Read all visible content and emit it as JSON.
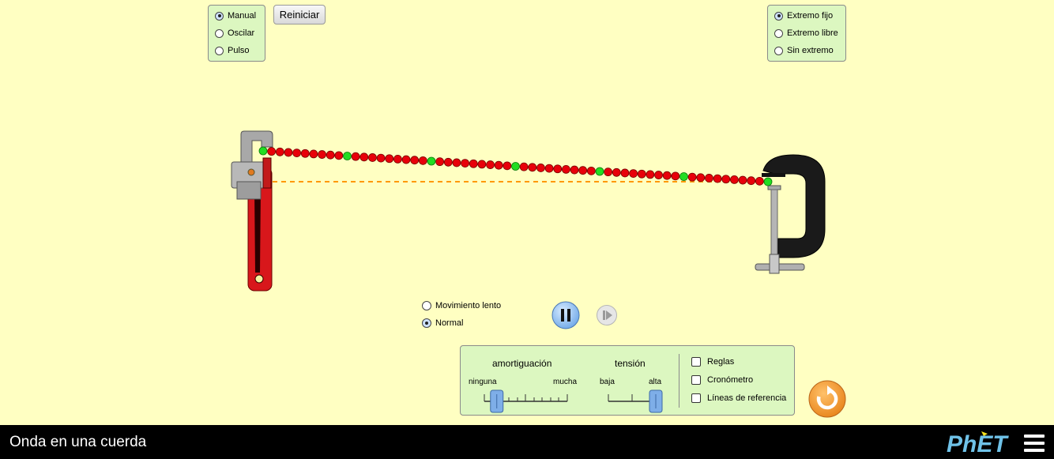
{
  "wave_mode": {
    "options": [
      {
        "label": "Manual",
        "selected": true
      },
      {
        "label": "Oscilar",
        "selected": false
      },
      {
        "label": "Pulso",
        "selected": false
      }
    ]
  },
  "reset_label": "Reiniciar",
  "end_mode": {
    "options": [
      {
        "label": "Extremo fijo",
        "selected": true
      },
      {
        "label": "Extremo libre",
        "selected": false
      },
      {
        "label": "Sin extremo",
        "selected": false
      }
    ]
  },
  "speed": {
    "options": [
      {
        "label": "Movimiento lento",
        "selected": false
      },
      {
        "label": "Normal",
        "selected": true
      }
    ]
  },
  "controls": {
    "damping": {
      "title": "amortiguación",
      "min_label": "ninguna",
      "max_label": "mucha",
      "value": 0.15
    },
    "tension": {
      "title": "tensión",
      "min_label": "baja",
      "max_label": "alta",
      "value": 1.0
    },
    "checkboxes": [
      {
        "label": "Reglas",
        "checked": false
      },
      {
        "label": "Cronómetro",
        "checked": false
      },
      {
        "label": "Líneas de referencia",
        "checked": false
      }
    ]
  },
  "footer": {
    "title": "Onda en una cuerda",
    "logo": "PhET",
    "menu_icon": "hamburger-menu-icon"
  },
  "colors": {
    "background": "#ffffc2",
    "panel": "#dcf7c0",
    "bead_red": "#e8000a",
    "bead_green": "#22dd22",
    "reference_line": "#ff9900",
    "reset_all": "#f3941d"
  },
  "icons": {
    "wrench": "pipe-wrench-icon",
    "clamp": "c-clamp-icon",
    "pause": "pause-icon",
    "step": "step-forward-icon",
    "reset_all": "reset-all-icon"
  }
}
